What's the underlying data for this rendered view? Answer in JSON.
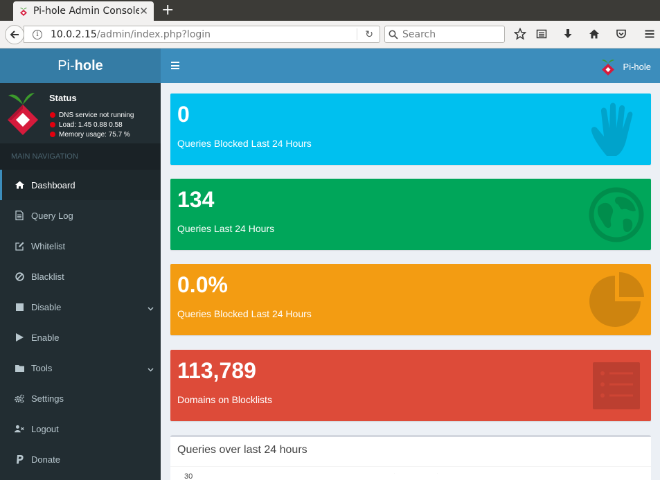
{
  "browser": {
    "tab_title": "Pi-hole Admin Console",
    "url_host": "10.0.2.15",
    "url_path": "/admin/index.php?login",
    "search_placeholder": "Search"
  },
  "header": {
    "logo_prefix": "Pi-",
    "logo_bold": "hole",
    "user_name": "Pi-hole"
  },
  "sidebar": {
    "status_title": "Status",
    "status_lines": [
      {
        "text": "DNS service not running",
        "color": "#e3000f"
      },
      {
        "text": "Load:  1.45  0.88  0.58",
        "color": "#e3000f"
      },
      {
        "text": "Memory usage:  75.7 %",
        "color": "#e3000f"
      }
    ],
    "nav_header": "MAIN NAVIGATION",
    "items": [
      {
        "label": "Dashboard",
        "icon": "home-icon",
        "active": true
      },
      {
        "label": "Query Log",
        "icon": "file-text-icon"
      },
      {
        "label": "Whitelist",
        "icon": "edit-icon"
      },
      {
        "label": "Blacklist",
        "icon": "ban-icon"
      },
      {
        "label": "Disable",
        "icon": "stop-icon",
        "expandable": true
      },
      {
        "label": "Enable",
        "icon": "play-icon"
      },
      {
        "label": "Tools",
        "icon": "folder-icon",
        "expandable": true
      },
      {
        "label": "Settings",
        "icon": "gears-icon"
      },
      {
        "label": "Logout",
        "icon": "user-times-icon"
      },
      {
        "label": "Donate",
        "icon": "paypal-icon"
      }
    ]
  },
  "stats": [
    {
      "value": "0",
      "label": "Queries Blocked Last 24 Hours",
      "color": "#00c0ef",
      "icon": "hand-stop-icon"
    },
    {
      "value": "134",
      "label": "Queries Last 24 Hours",
      "color": "#00a65a",
      "icon": "globe-icon"
    },
    {
      "value": "0.0%",
      "label": "Queries Blocked Last 24 Hours",
      "color": "#f39c12",
      "icon": "pie-chart-icon"
    },
    {
      "value": "113,789",
      "label": "Domains on Blocklists",
      "color": "#dd4b39",
      "icon": "list-icon"
    }
  ],
  "chart": {
    "title": "Queries over last 24 hours",
    "y_tick": "30"
  }
}
